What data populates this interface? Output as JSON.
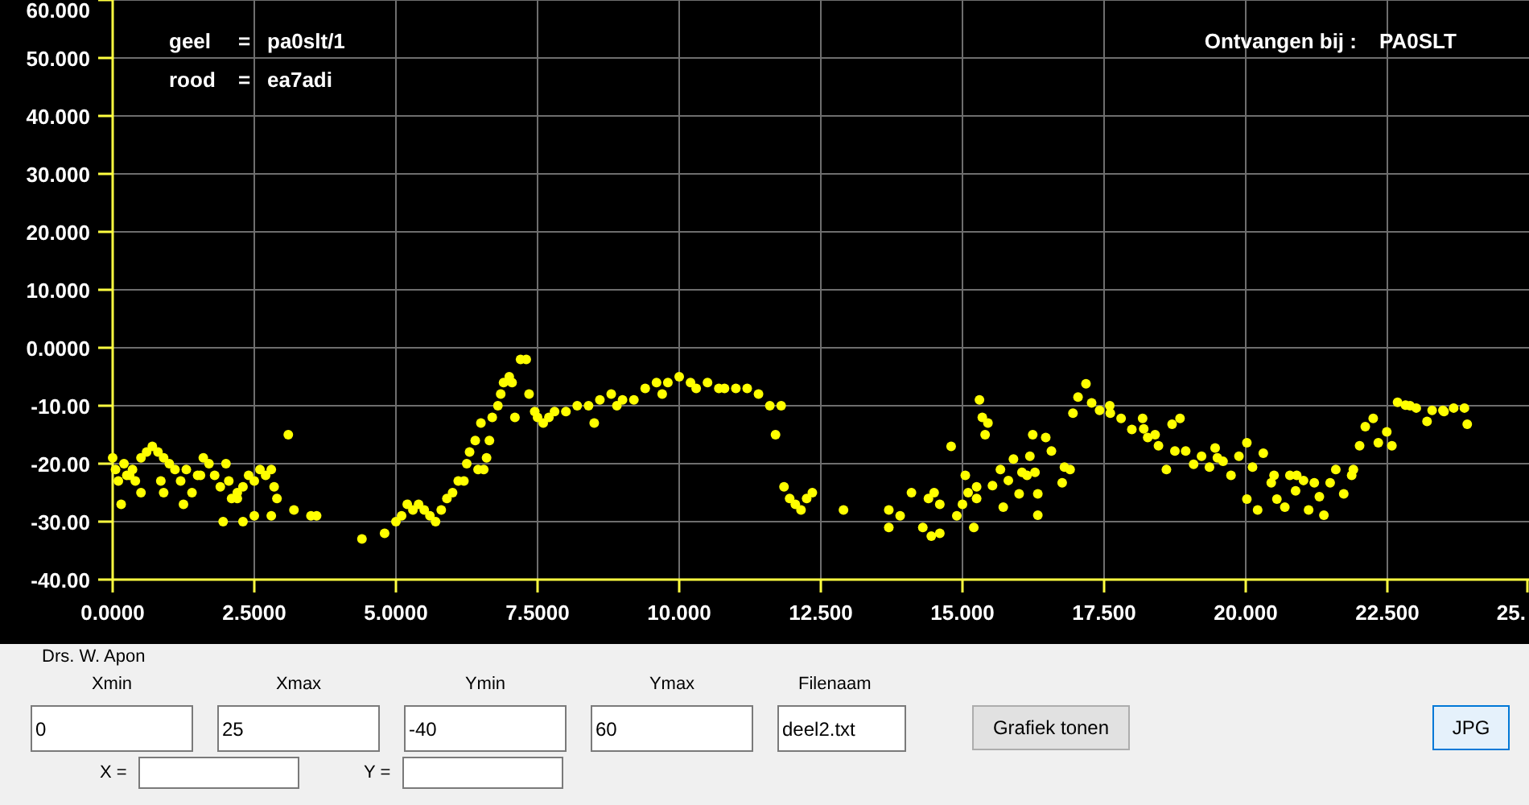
{
  "chart_data": {
    "type": "scatter",
    "grid": true,
    "xlim": [
      0,
      25
    ],
    "ylim": [
      -40,
      60
    ],
    "xticks": [
      {
        "value": 0,
        "label": "0.0000"
      },
      {
        "value": 2.5,
        "label": "2.5000"
      },
      {
        "value": 5,
        "label": "5.0000"
      },
      {
        "value": 7.5,
        "label": "7.5000"
      },
      {
        "value": 10,
        "label": "10.000"
      },
      {
        "value": 12.5,
        "label": "12.500"
      },
      {
        "value": 15,
        "label": "15.000"
      },
      {
        "value": 17.5,
        "label": "17.500"
      },
      {
        "value": 20,
        "label": "20.000"
      },
      {
        "value": 22.5,
        "label": "22.500"
      },
      {
        "value": 25,
        "label": "25."
      }
    ],
    "yticks": [
      {
        "value": 60,
        "label": "60.000"
      },
      {
        "value": 50,
        "label": "50.000"
      },
      {
        "value": 40,
        "label": "40.000"
      },
      {
        "value": 30,
        "label": "30.000"
      },
      {
        "value": 20,
        "label": "20.000"
      },
      {
        "value": 10,
        "label": "10.000"
      },
      {
        "value": 0,
        "label": "0.0000"
      },
      {
        "value": -10,
        "label": "-10.00"
      },
      {
        "value": -20,
        "label": "-20.00"
      },
      {
        "value": -30,
        "label": "-30.00"
      },
      {
        "value": -40,
        "label": "-40.00"
      }
    ],
    "x": [
      0,
      0.05,
      0.1,
      0.15,
      0.2,
      0.25,
      0.35,
      0.4,
      0.5,
      0.6,
      0.7,
      0.8,
      0.9,
      1.0,
      1.1,
      0.85,
      0.5,
      0.9,
      1.2,
      1.3,
      1.25,
      1.4,
      1.5,
      1.6,
      1.7,
      1.8,
      1.9,
      2.0,
      2.05,
      2.1,
      2.2,
      2.3,
      2.4,
      2.5,
      2.6,
      2.7,
      2.8,
      2.85,
      2.9,
      1.95,
      2.3,
      2.5,
      2.8,
      3.1,
      3.2,
      3.5,
      3.6,
      2.2,
      0.3,
      1.55,
      4.4,
      4.8,
      5.0,
      5.1,
      5.2,
      5.3,
      5.4,
      5.5,
      5.6,
      5.7,
      5.8,
      5.9,
      6.0,
      6.1,
      6.2,
      6.25,
      6.3,
      6.4,
      6.5,
      6.45,
      6.55,
      6.6,
      6.65,
      6.7,
      6.8,
      6.85,
      6.9,
      7.0,
      7.05,
      7.1,
      7.2,
      7.3,
      7.35,
      7.45,
      7.5,
      7.6,
      7.7,
      7.8,
      8.0,
      8.2,
      8.4,
      8.5,
      8.6,
      8.8,
      8.9,
      9.0,
      9.2,
      9.4,
      9.6,
      9.7,
      9.8,
      10.0,
      10.2,
      10.3,
      10.5,
      10.7,
      10.8,
      11.0,
      11.2,
      11.4,
      11.6,
      11.8,
      11.7,
      11.85,
      11.95,
      12.05,
      12.15,
      12.25,
      12.35,
      12.9,
      13.7,
      13.7,
      13.9,
      14.1,
      14.3,
      14.4,
      14.45,
      14.6,
      14.6,
      14.5,
      14.8,
      14.9,
      15.0,
      15.05,
      15.1,
      15.2,
      15.25,
      15.25,
      15.3,
      15.35,
      15.4,
      15.45,
      15.53,
      15.67,
      15.72,
      15.81,
      15.9,
      16.0,
      16.05,
      16.14,
      16.19,
      16.24,
      16.28,
      16.33,
      16.33,
      16.47,
      16.57,
      16.76,
      16.8,
      16.9,
      16.95,
      17.04,
      17.18,
      17.28,
      17.42,
      17.61,
      17.8,
      17.99,
      18.18,
      18.27,
      18.46,
      18.6,
      18.7,
      18.75,
      18.84,
      18.94,
      19.08,
      19.22,
      19.36,
      19.46,
      19.6,
      19.74,
      19.88,
      20.02,
      20.02,
      20.12,
      20.21,
      20.31,
      20.45,
      20.55,
      20.69,
      20.78,
      20.88,
      21.02,
      21.11,
      21.21,
      21.3,
      21.38,
      21.49,
      21.59,
      21.73,
      21.87,
      22.01,
      22.11,
      22.25,
      22.34,
      22.49,
      22.58,
      22.68,
      22.82,
      23.01,
      23.2,
      23.29,
      23.48,
      23.67,
      23.86,
      23.91,
      17.6,
      18.2,
      18.4,
      19.5,
      20.5,
      20.9,
      21.9,
      22.9,
      23.5
    ],
    "series": [
      {
        "color": "#ffff00",
        "values": [
          -19,
          -21,
          -23,
          -27,
          -20,
          -22,
          -21,
          -23,
          -19,
          -18,
          -17,
          -18,
          -19,
          -20,
          -21,
          -23,
          -25,
          -25,
          -23,
          -21,
          -27,
          -25,
          -22,
          -19,
          -20,
          -22,
          -24,
          -20,
          -23,
          -26,
          -26,
          -24,
          -22,
          -23,
          -21,
          -22,
          -21,
          -24,
          -26,
          -30,
          -30,
          -29,
          -29,
          -15,
          -28,
          -29,
          -29,
          -25,
          -22,
          -22,
          -33,
          -32,
          -30,
          -29,
          -27,
          -28,
          -27,
          -28,
          -29,
          -30,
          -28,
          -26,
          -25,
          -23,
          -23,
          -20,
          -18,
          -16,
          -13,
          -21,
          -21,
          -19,
          -16,
          -12,
          -10,
          -8,
          -6,
          -5,
          -6,
          -12,
          -2,
          -2,
          -8,
          -11,
          -12,
          -13,
          -12,
          -11,
          -11,
          -10,
          -10,
          -13,
          -9,
          -8,
          -10,
          -9,
          -9,
          -7,
          -6,
          -8,
          -6,
          -5,
          -6,
          -7,
          -6,
          -7,
          -7,
          -7,
          -7,
          -8,
          -10,
          -10,
          -15,
          -24,
          -26,
          -27,
          -28,
          -26,
          -25,
          -28,
          -28,
          -31,
          -29,
          -25,
          -31,
          -26,
          -32.5,
          -32,
          -27,
          -25,
          -17,
          -29,
          -27,
          -22,
          -25,
          -31,
          -24,
          -26,
          -9,
          -12,
          -15,
          -13,
          -23.8,
          -21,
          -27.5,
          -22.9,
          -19.2,
          -25.2,
          -21.5,
          -22,
          -18.7,
          -15,
          -21.5,
          -25.2,
          -28.9,
          -15.5,
          -17.8,
          -23.3,
          -20.6,
          -21,
          -11.3,
          -8.5,
          -6.2,
          -9.5,
          -10.8,
          -11.3,
          -12.2,
          -14.1,
          -12.2,
          -15.5,
          -16.9,
          -21,
          -13.2,
          -17.8,
          -12.2,
          -17.8,
          -20.1,
          -18.7,
          -20.6,
          -17.3,
          -19.6,
          -22,
          -18.7,
          -16.4,
          -26.1,
          -20.6,
          -28,
          -18.2,
          -23.3,
          -26.1,
          -27.5,
          -22,
          -24.7,
          -22.9,
          -28,
          -23.3,
          -25.7,
          -28.9,
          -23.3,
          -21,
          -25.2,
          -22,
          -16.9,
          -13.6,
          -12.2,
          -16.4,
          -14.5,
          -16.9,
          -9.4,
          -9.9,
          -10.4,
          -12.7,
          -10.8,
          -10.8,
          -10.4,
          -10.4,
          -13.2,
          -10,
          -14,
          -15,
          -19,
          -22,
          -22,
          -21,
          -10,
          -11
        ]
      }
    ]
  },
  "legend": [
    {
      "color_name": "geel",
      "separator": "=",
      "value": "pa0slt/1"
    },
    {
      "color_name": "rood",
      "separator": "=",
      "value": "ea7adi"
    }
  ],
  "received": {
    "label": "Ontvangen bij :",
    "value": "PA0SLT"
  },
  "author": "Drs. W. Apon",
  "fields": [
    {
      "label": "Xmin",
      "value": "0",
      "kind": "wide"
    },
    {
      "label": "Xmax",
      "value": "25",
      "kind": "wide"
    },
    {
      "label": "Ymin",
      "value": "-40",
      "kind": "wide"
    },
    {
      "label": "Ymax",
      "value": "60",
      "kind": "wide"
    },
    {
      "label": "Filenaam",
      "value": "deel2.txt",
      "kind": "narrow"
    }
  ],
  "buttons": [
    {
      "label": "Grafiek tonen",
      "focused": false
    },
    {
      "label": "JPG",
      "focused": true
    }
  ],
  "coordinates": [
    {
      "label": "X ="
    },
    {
      "label": "Y ="
    }
  ]
}
